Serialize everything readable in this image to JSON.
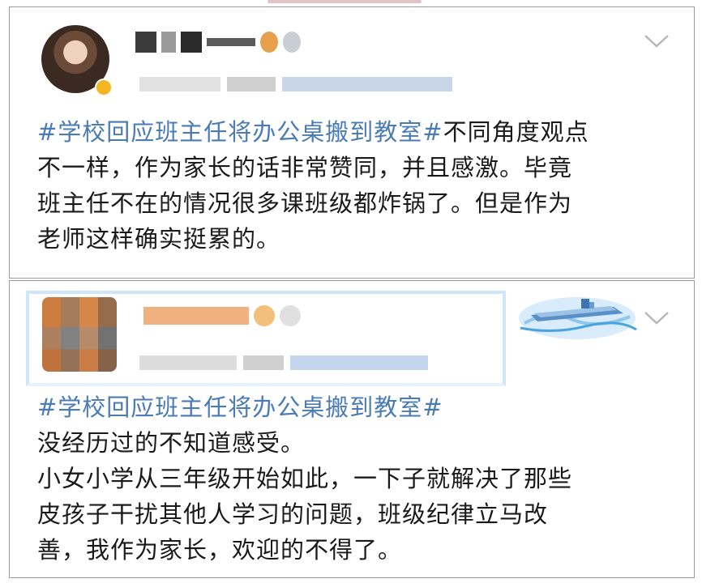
{
  "posts": [
    {
      "hashtag": "#学校回应班主任将办公桌搬到教室#",
      "lines": [
        "不同角度观点",
        "不一样，作为家长的话非常赞同，并且感激。毕竟",
        "班主任不在的情况很多课班级都炸锅了。但是作为",
        "老师这样确实挺累的。"
      ]
    },
    {
      "hashtag": "#学校回应班主任将办公桌搬到教室#",
      "lines": [
        "没经历过的不知道感受。",
        "小女小学从三年级开始如此，一下子就解决了那些",
        "皮孩子干扰其他人学习的问题，班级纪律立马改",
        "善，我作为家长，欢迎的不得了。"
      ]
    }
  ],
  "colors": {
    "hashtag": "#4a7bb2",
    "text": "#1a1a1a",
    "border": "#9a9a9a"
  },
  "icons": {
    "more": "chevron-down-icon",
    "avatar_badge": "vip-badge-icon"
  }
}
